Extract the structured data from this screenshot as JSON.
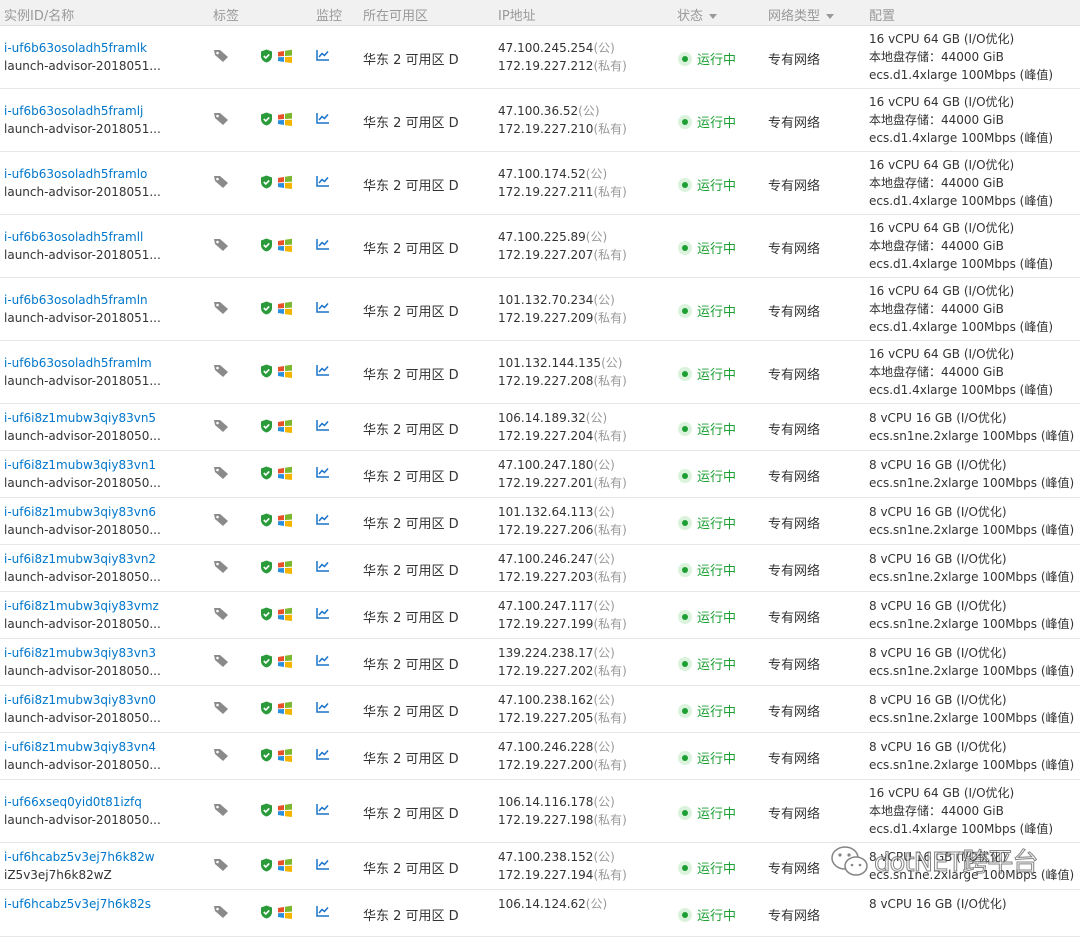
{
  "header": {
    "col_id": "实例ID/名称",
    "col_tags": "标签",
    "col_monitor": "监控",
    "col_zone": "所在可用区",
    "col_ip": "IP地址",
    "col_status": "状态",
    "col_network": "网络类型",
    "col_config": "配置"
  },
  "labels": {
    "public": "(公)",
    "private": "(私有)"
  },
  "rows": [
    {
      "id": "i-uf6b63osoladh5framlk",
      "name": "launch-advisor-2018051...",
      "zone": "华东 2 可用区 D",
      "pub": "47.100.245.254",
      "priv": "172.19.227.212",
      "status": "运行中",
      "net": "专有网络",
      "cfg1": "16 vCPU 64 GB (I/O优化)",
      "cfg2": "本地盘存储：44000 GiB",
      "cfg3": "ecs.d1.4xlarge   100Mbps (峰值)"
    },
    {
      "id": "i-uf6b63osoladh5framlj",
      "name": "launch-advisor-2018051...",
      "zone": "华东 2 可用区 D",
      "pub": "47.100.36.52",
      "priv": "172.19.227.210",
      "status": "运行中",
      "net": "专有网络",
      "cfg1": "16 vCPU 64 GB (I/O优化)",
      "cfg2": "本地盘存储：44000 GiB",
      "cfg3": "ecs.d1.4xlarge   100Mbps (峰值)"
    },
    {
      "id": "i-uf6b63osoladh5framlo",
      "name": "launch-advisor-2018051...",
      "zone": "华东 2 可用区 D",
      "pub": "47.100.174.52",
      "priv": "172.19.227.211",
      "status": "运行中",
      "net": "专有网络",
      "cfg1": "16 vCPU 64 GB (I/O优化)",
      "cfg2": "本地盘存储：44000 GiB",
      "cfg3": "ecs.d1.4xlarge   100Mbps (峰值)"
    },
    {
      "id": "i-uf6b63osoladh5framll",
      "name": "launch-advisor-2018051...",
      "zone": "华东 2 可用区 D",
      "pub": "47.100.225.89",
      "priv": "172.19.227.207",
      "status": "运行中",
      "net": "专有网络",
      "cfg1": "16 vCPU 64 GB (I/O优化)",
      "cfg2": "本地盘存储：44000 GiB",
      "cfg3": "ecs.d1.4xlarge   100Mbps (峰值)"
    },
    {
      "id": "i-uf6b63osoladh5framln",
      "name": "launch-advisor-2018051...",
      "zone": "华东 2 可用区 D",
      "pub": "101.132.70.234",
      "priv": "172.19.227.209",
      "status": "运行中",
      "net": "专有网络",
      "cfg1": "16 vCPU 64 GB (I/O优化)",
      "cfg2": "本地盘存储：44000 GiB",
      "cfg3": "ecs.d1.4xlarge   100Mbps (峰值)"
    },
    {
      "id": "i-uf6b63osoladh5framlm",
      "name": "launch-advisor-2018051...",
      "zone": "华东 2 可用区 D",
      "pub": "101.132.144.135",
      "priv": "172.19.227.208",
      "status": "运行中",
      "net": "专有网络",
      "cfg1": "16 vCPU 64 GB (I/O优化)",
      "cfg2": "本地盘存储：44000 GiB",
      "cfg3": "ecs.d1.4xlarge   100Mbps (峰值)"
    },
    {
      "id": "i-uf6i8z1mubw3qiy83vn5",
      "name": "launch-advisor-2018050...",
      "zone": "华东 2 可用区 D",
      "pub": "106.14.189.32",
      "priv": "172.19.227.204",
      "status": "运行中",
      "net": "专有网络",
      "cfg1": "8 vCPU 16 GB (I/O优化)",
      "cfg2": "ecs.sn1ne.2xlarge   100Mbps (峰值)"
    },
    {
      "id": "i-uf6i8z1mubw3qiy83vn1",
      "name": "launch-advisor-2018050...",
      "zone": "华东 2 可用区 D",
      "pub": "47.100.247.180",
      "priv": "172.19.227.201",
      "status": "运行中",
      "net": "专有网络",
      "cfg1": "8 vCPU 16 GB (I/O优化)",
      "cfg2": "ecs.sn1ne.2xlarge   100Mbps (峰值)"
    },
    {
      "id": "i-uf6i8z1mubw3qiy83vn6",
      "name": "launch-advisor-2018050...",
      "zone": "华东 2 可用区 D",
      "pub": "101.132.64.113",
      "priv": "172.19.227.206",
      "status": "运行中",
      "net": "专有网络",
      "cfg1": "8 vCPU 16 GB (I/O优化)",
      "cfg2": "ecs.sn1ne.2xlarge   100Mbps (峰值)"
    },
    {
      "id": "i-uf6i8z1mubw3qiy83vn2",
      "name": "launch-advisor-2018050...",
      "zone": "华东 2 可用区 D",
      "pub": "47.100.246.247",
      "priv": "172.19.227.203",
      "status": "运行中",
      "net": "专有网络",
      "cfg1": "8 vCPU 16 GB (I/O优化)",
      "cfg2": "ecs.sn1ne.2xlarge   100Mbps (峰值)"
    },
    {
      "id": "i-uf6i8z1mubw3qiy83vmz",
      "name": "launch-advisor-2018050...",
      "zone": "华东 2 可用区 D",
      "pub": "47.100.247.117",
      "priv": "172.19.227.199",
      "status": "运行中",
      "net": "专有网络",
      "cfg1": "8 vCPU 16 GB (I/O优化)",
      "cfg2": "ecs.sn1ne.2xlarge   100Mbps (峰值)"
    },
    {
      "id": "i-uf6i8z1mubw3qiy83vn3",
      "name": "launch-advisor-2018050...",
      "zone": "华东 2 可用区 D",
      "pub": "139.224.238.17",
      "priv": "172.19.227.202",
      "status": "运行中",
      "net": "专有网络",
      "cfg1": "8 vCPU 16 GB (I/O优化)",
      "cfg2": "ecs.sn1ne.2xlarge   100Mbps (峰值)"
    },
    {
      "id": "i-uf6i8z1mubw3qiy83vn0",
      "name": "launch-advisor-2018050...",
      "zone": "华东 2 可用区 D",
      "pub": "47.100.238.162",
      "priv": "172.19.227.205",
      "status": "运行中",
      "net": "专有网络",
      "cfg1": "8 vCPU 16 GB (I/O优化)",
      "cfg2": "ecs.sn1ne.2xlarge   100Mbps (峰值)"
    },
    {
      "id": "i-uf6i8z1mubw3qiy83vn4",
      "name": "launch-advisor-2018050...",
      "zone": "华东 2 可用区 D",
      "pub": "47.100.246.228",
      "priv": "172.19.227.200",
      "status": "运行中",
      "net": "专有网络",
      "cfg1": "8 vCPU 16 GB (I/O优化)",
      "cfg2": "ecs.sn1ne.2xlarge   100Mbps (峰值)"
    },
    {
      "id": "i-uf66xseq0yid0t81izfq",
      "name": "launch-advisor-2018050...",
      "zone": "华东 2 可用区 D",
      "pub": "106.14.116.178",
      "priv": "172.19.227.198",
      "status": "运行中",
      "net": "专有网络",
      "cfg1": "16 vCPU 64 GB (I/O优化)",
      "cfg2": "本地盘存储：44000 GiB",
      "cfg3": "ecs.d1.4xlarge   100Mbps (峰值)"
    },
    {
      "id": "i-uf6hcabz5v3ej7h6k82w",
      "name": "iZ5v3ej7h6k82wZ",
      "zone": "华东 2 可用区 D",
      "pub": "47.100.238.152",
      "priv": "172.19.227.194",
      "status": "运行中",
      "net": "专有网络",
      "cfg1": "8 vCPU 16 GB (I/O优化)",
      "cfg2": "ecs.sn1ne.2xlarge   100Mbps (峰值)"
    },
    {
      "id": "i-uf6hcabz5v3ej7h6k82s",
      "name": "",
      "zone": "华东 2 可用区 D",
      "pub": "106.14.124.62",
      "priv": "",
      "status": "运行中",
      "net": "专有网络",
      "cfg1": "8 vCPU 16 GB (I/O优化)",
      "cfg2": ""
    }
  ],
  "watermark": {
    "text": "dotNET跨平台"
  },
  "colors": {
    "link": "#0077cc",
    "running": "#1d9f33",
    "header_bg": "#f1f1f1",
    "muted": "#999999"
  }
}
